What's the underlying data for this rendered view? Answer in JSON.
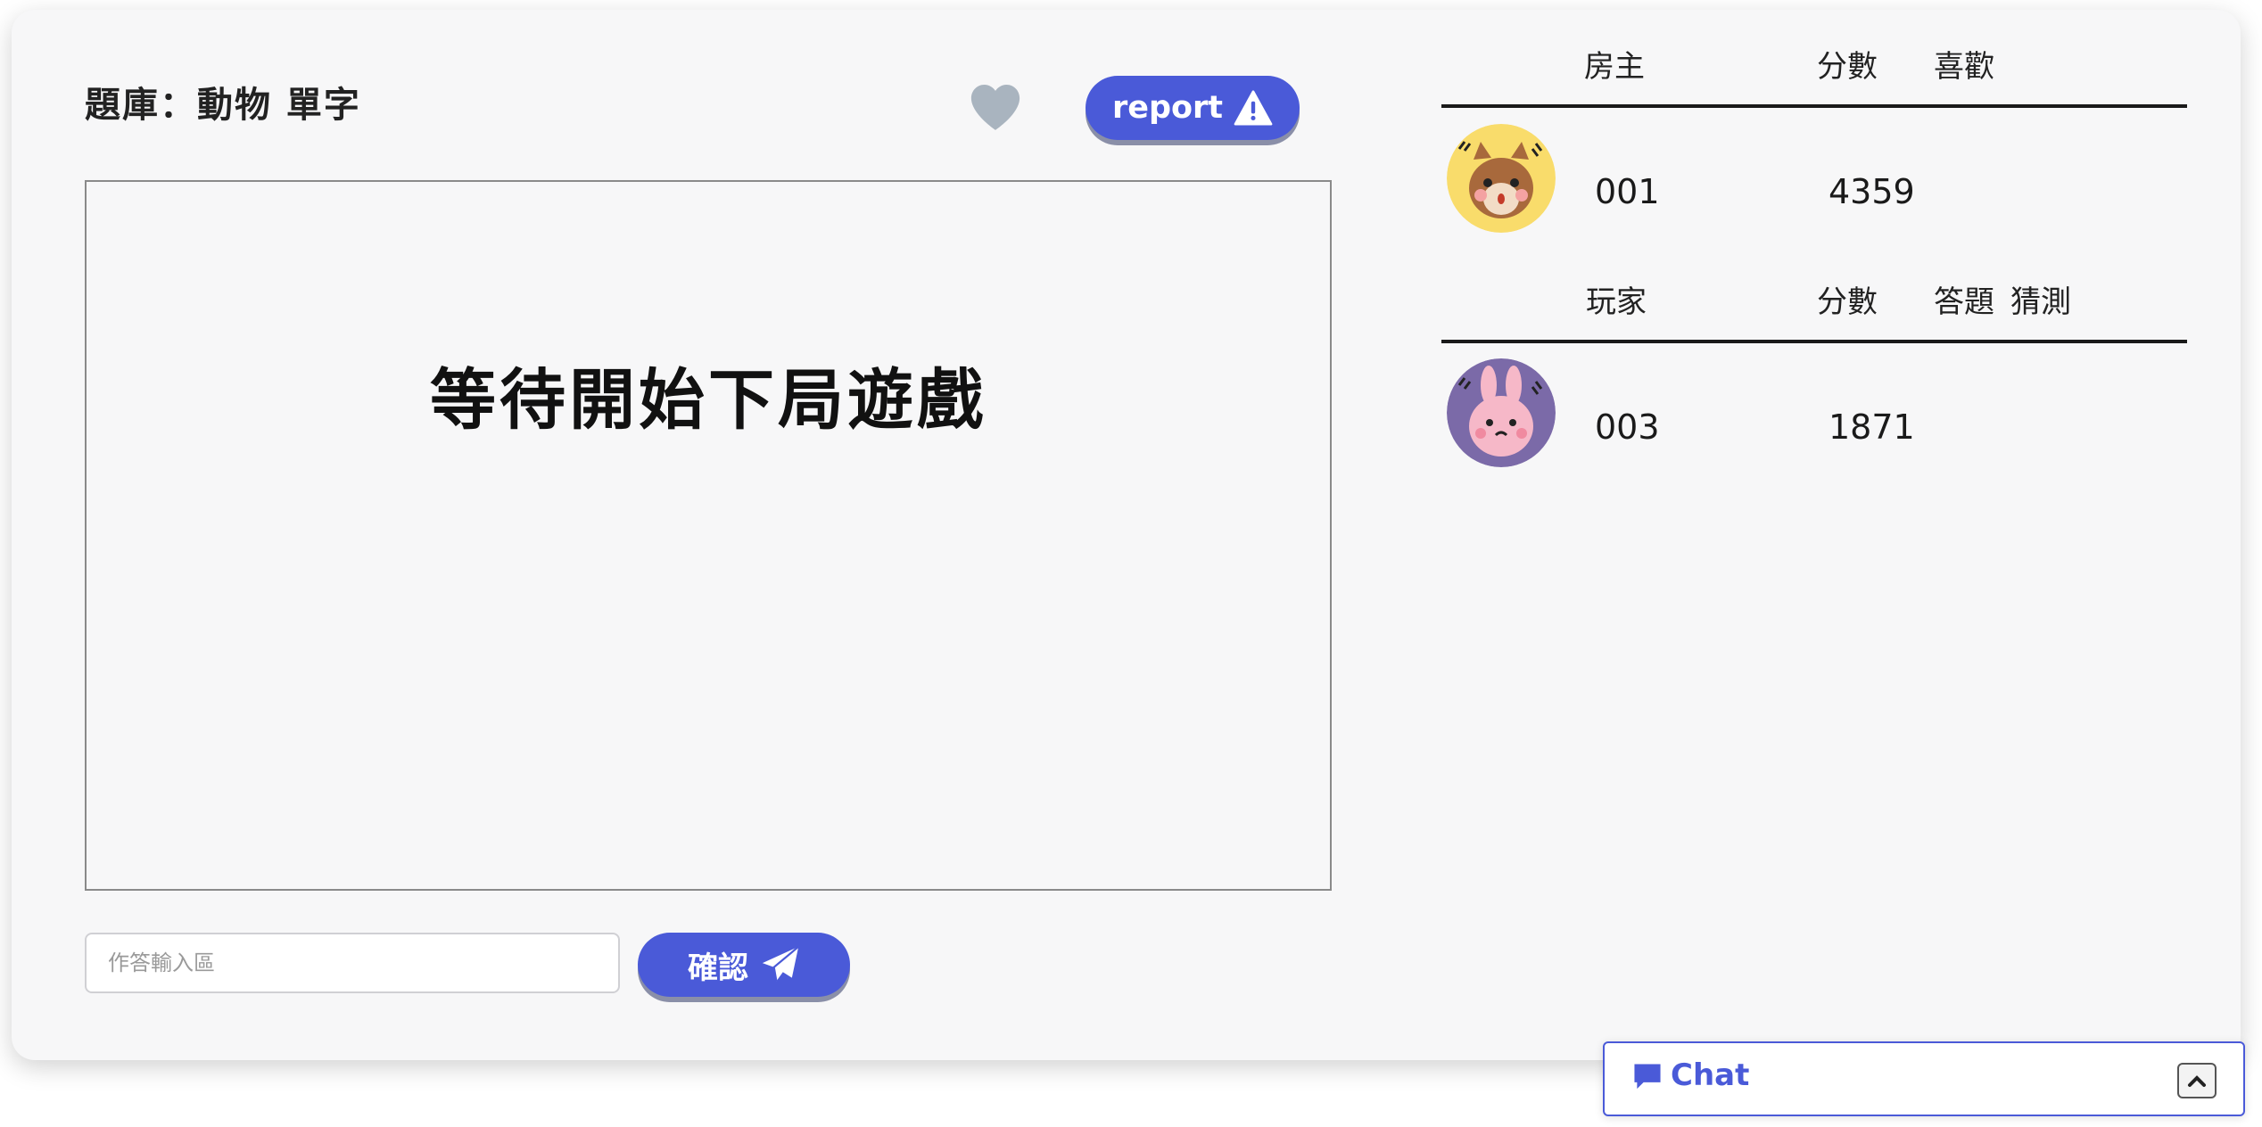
{
  "game": {
    "title": "題庫：動物 單字",
    "report_label": "report",
    "canvas_message": "等待開始下局遊戲",
    "answer_placeholder": "作答輸入區",
    "answer_value": "",
    "confirm_label": "確認"
  },
  "host_table": {
    "headers": [
      "房主",
      "分數",
      "喜歡"
    ],
    "rows": [
      {
        "avatar": "squirrel-avatar",
        "name": "001",
        "score": "4359",
        "liked": ""
      }
    ]
  },
  "player_table": {
    "headers": [
      "玩家",
      "分數",
      "答題",
      "猜測"
    ],
    "rows": [
      {
        "avatar": "rabbit-avatar",
        "name": "003",
        "score": "1871",
        "answer": "",
        "guess": ""
      }
    ]
  },
  "chat": {
    "label": "Chat"
  },
  "colors": {
    "accent": "#4a5ad8",
    "heart": "#a9b4bf",
    "card_bg": "#f7f7f8"
  },
  "icons": {
    "like": "heart-icon",
    "report": "warning-triangle-icon",
    "confirm": "paper-plane-icon",
    "chat": "comment-icon",
    "chat_toggle": "chevron-up-icon"
  }
}
